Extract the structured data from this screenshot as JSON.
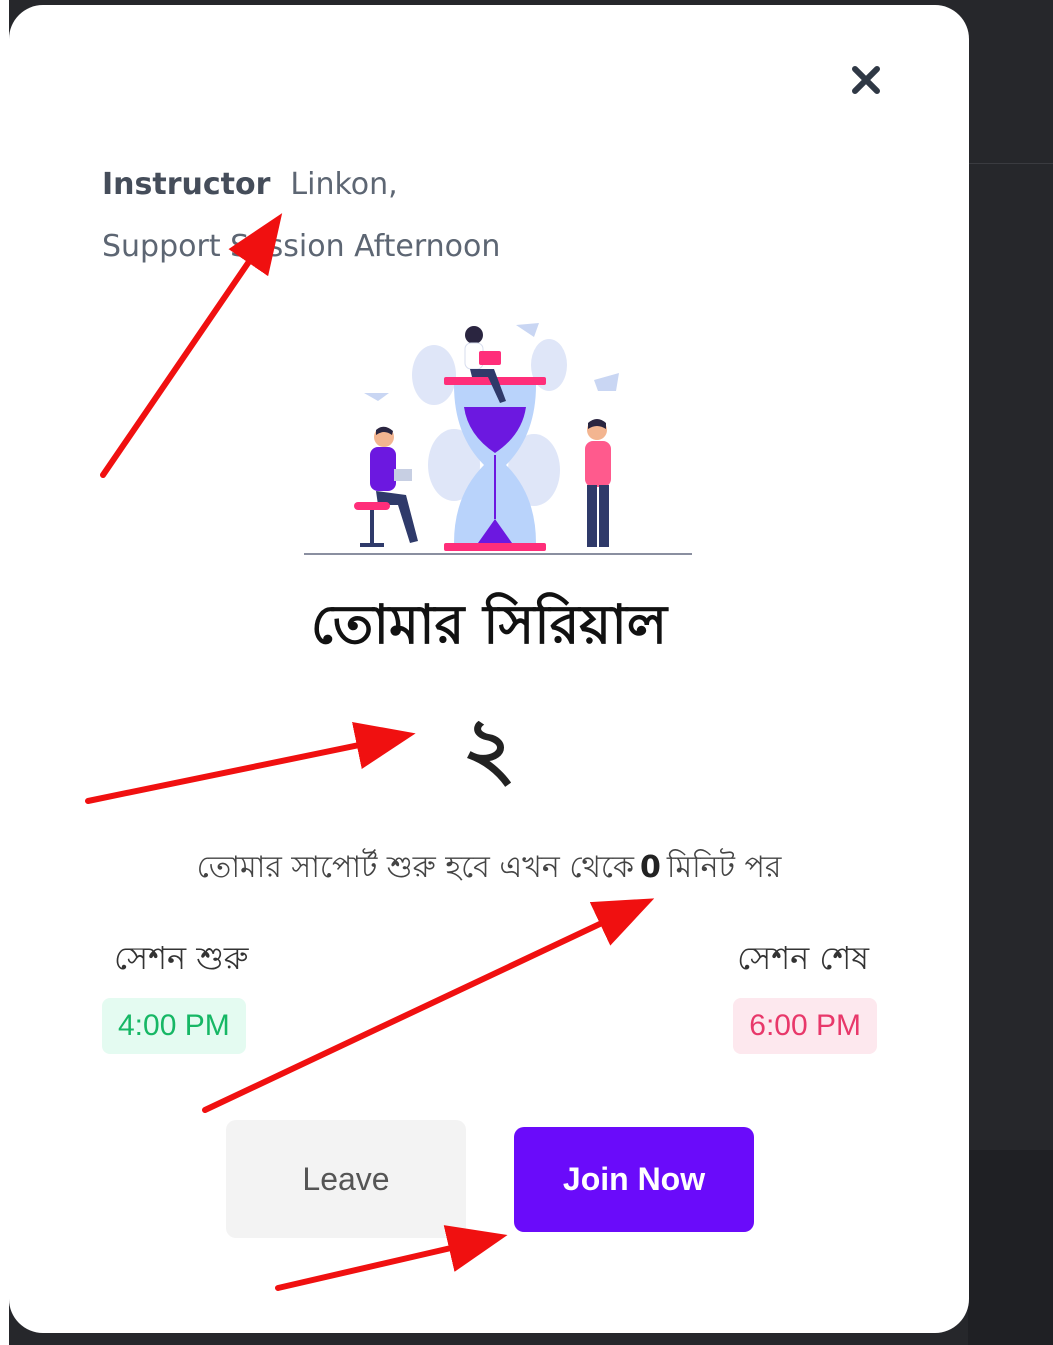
{
  "modal": {
    "close_icon": "close-icon",
    "instructor_label": "Instructor",
    "instructor_name": "Linkon,",
    "session_name": "Support Session Afternoon",
    "illustration_icon": "hourglass-waiting-illustration",
    "serial_title": "তোমার সিরিয়াল",
    "serial_number": "২",
    "wait_before": "তোমার সাপোর্ট শুরু হবে এখন থেকে",
    "wait_minutes": "0",
    "wait_after": "মিনিট পর",
    "session_start_label": "সেশন শুরু",
    "session_start_time": "4:00 PM",
    "session_end_label": "সেশন শেষ",
    "session_end_time": "6:00 PM",
    "leave_label": "Leave",
    "join_label": "Join Now"
  },
  "colors": {
    "primary": "#6a0bfa",
    "start_time": "#16b765",
    "end_time": "#e8386a",
    "annotation_arrow": "#f01010"
  }
}
